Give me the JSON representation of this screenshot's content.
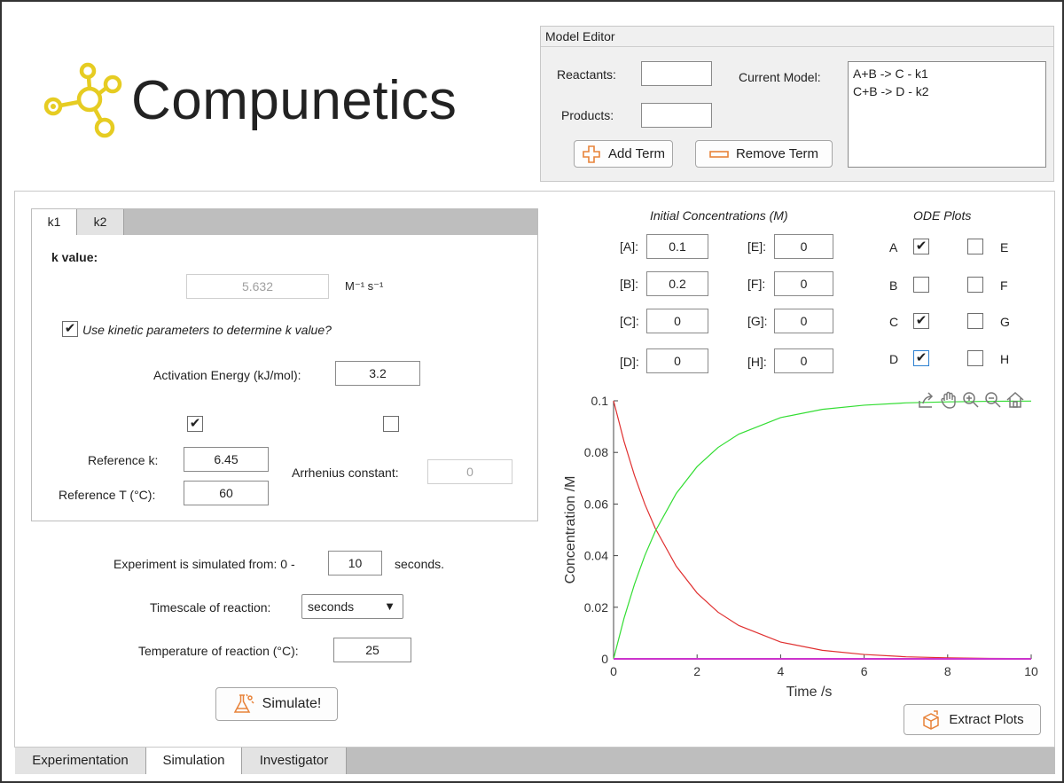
{
  "brand": {
    "name": "Compunetics",
    "accent": "#e6cc22"
  },
  "model_editor": {
    "title": "Model Editor",
    "reactants_label": "Reactants:",
    "reactants_value": "",
    "products_label": "Products:",
    "products_value": "",
    "current_model_label": "Current Model:",
    "current_model_lines": [
      "A+B -> C  - k1",
      "C+B -> D  - k2"
    ],
    "add_term": "Add Term",
    "remove_term": "Remove Term"
  },
  "k_tabs": {
    "tabs": [
      "k1",
      "k2"
    ],
    "active": "k1",
    "k_value_label": "k value:",
    "k_value": "5.632",
    "k_units": "M⁻¹ s⁻¹",
    "use_kinetic_label": "Use kinetic parameters to determine k value?",
    "use_kinetic_checked": true,
    "activation_energy_label": "Activation Energy (kJ/mol):",
    "activation_energy": "3.2",
    "left_checkbox_checked": true,
    "right_checkbox_checked": false,
    "reference_k_label": "Reference k:",
    "reference_k": "6.45",
    "reference_t_label": "Reference T (°C):",
    "reference_t": "60",
    "arrhenius_label": "Arrhenius constant:",
    "arrhenius_value": "0"
  },
  "simulation": {
    "simulated_from_label": "Experiment is simulated from: 0  -",
    "simulated_to": "10",
    "seconds_label": "seconds.",
    "timescale_label": "Timescale of reaction:",
    "timescale_value": "seconds",
    "temperature_label": "Temperature of reaction (°C):",
    "temperature_value": "25",
    "simulate_button": "Simulate!"
  },
  "initial_concentrations": {
    "title": "Initial Concentrations (M)",
    "items": [
      {
        "label": "[A]:",
        "value": "0.1"
      },
      {
        "label": "[B]:",
        "value": "0.2"
      },
      {
        "label": "[C]:",
        "value": "0"
      },
      {
        "label": "[D]:",
        "value": "0"
      },
      {
        "label": "[E]:",
        "value": "0"
      },
      {
        "label": "[F]:",
        "value": "0"
      },
      {
        "label": "[G]:",
        "value": "0"
      },
      {
        "label": "[H]:",
        "value": "0"
      }
    ]
  },
  "ode_plots": {
    "title": "ODE Plots",
    "items": [
      {
        "label": "A",
        "checked": true
      },
      {
        "label": "B",
        "checked": false
      },
      {
        "label": "C",
        "checked": true
      },
      {
        "label": "D",
        "checked": true
      },
      {
        "label": "E",
        "checked": false
      },
      {
        "label": "F",
        "checked": false
      },
      {
        "label": "G",
        "checked": false
      },
      {
        "label": "H",
        "checked": false
      }
    ]
  },
  "extract_plots": "Extract Plots",
  "bottom_tabs": {
    "tabs": [
      "Experimentation",
      "Simulation",
      "Investigator"
    ],
    "active": "Simulation"
  },
  "chart_data": {
    "type": "line",
    "xlabel": "Time /s",
    "ylabel": "Concentration /M",
    "xlim": [
      0,
      10
    ],
    "ylim": [
      0,
      0.1
    ],
    "xticks": [
      0,
      2,
      4,
      6,
      8,
      10
    ],
    "yticks": [
      0,
      0.02,
      0.04,
      0.06,
      0.08,
      0.1
    ],
    "ytick_labels": [
      "0",
      "0.02",
      "0.04",
      "0.06",
      "0.08",
      "0.1"
    ],
    "grid": false,
    "series": [
      {
        "color": "#e03030",
        "x": [
          0,
          0.25,
          0.5,
          0.75,
          1,
          1.5,
          2,
          2.5,
          3,
          4,
          5,
          6,
          7,
          8,
          9,
          10
        ],
        "y": [
          0.1,
          0.0843,
          0.0711,
          0.0599,
          0.0505,
          0.0359,
          0.0255,
          0.0181,
          0.0129,
          0.0065,
          0.0033,
          0.0017,
          0.0008,
          0.0004,
          0.0002,
          0.0001
        ]
      },
      {
        "color": "#33dd33",
        "x": [
          0,
          0.25,
          0.5,
          0.75,
          1,
          1.5,
          2,
          2.5,
          3,
          4,
          5,
          6,
          7,
          8,
          9,
          10
        ],
        "y": [
          0,
          0.0157,
          0.0289,
          0.0401,
          0.0495,
          0.0641,
          0.0745,
          0.0819,
          0.0871,
          0.0935,
          0.0967,
          0.0983,
          0.0992,
          0.0996,
          0.0998,
          0.0999
        ]
      },
      {
        "color": "#cc33cc",
        "x": [
          0,
          10
        ],
        "y": [
          0,
          0
        ]
      }
    ]
  }
}
